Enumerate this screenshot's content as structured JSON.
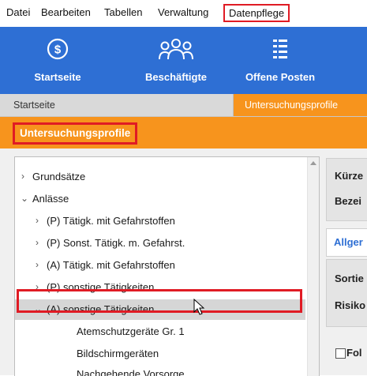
{
  "menubar": {
    "items": [
      "Datei",
      "Bearbeiten",
      "Tabellen",
      "Verwaltung",
      "Datenpflege"
    ]
  },
  "toolbar": {
    "buttons": [
      {
        "label": "Startseite",
        "icon": "home-dollar-icon"
      },
      {
        "label": "Beschäftigte",
        "icon": "people-group-icon"
      },
      {
        "label": "Offene Posten",
        "icon": "list-icon"
      }
    ]
  },
  "tabs": {
    "start": "Startseite",
    "active": "Untersuchungsprofile"
  },
  "title": "Untersuchungsprofile",
  "tree": {
    "items": [
      {
        "label": "Grundsätze",
        "state": "collapsed"
      },
      {
        "label": "Anlässe",
        "state": "expanded"
      },
      {
        "label": "(P) Tätigk. mit Gefahrstoffen",
        "state": "collapsed"
      },
      {
        "label": "(P) Sonst. Tätigk. m. Gefahrst.",
        "state": "collapsed"
      },
      {
        "label": "(A) Tätigk. mit Gefahrstoffen",
        "state": "collapsed"
      },
      {
        "label": "(P) sonstige Tätigkeiten",
        "state": "collapsed"
      },
      {
        "label": "(A) sonstige Tätigkeiten",
        "state": "expanded",
        "selected": true
      },
      {
        "label": "Atemschutzgeräte Gr. 1",
        "state": "leaf"
      },
      {
        "label": "Bildschirmgeräten",
        "state": "leaf"
      },
      {
        "label": "Nachgehende Vorsorge",
        "state": "leaf"
      }
    ]
  },
  "right_panel": {
    "field1": "Kürze",
    "field2": "Bezei",
    "tab": "Allger",
    "field3": "Sortie",
    "field4": "Risiko",
    "checkbox_label": "Fol"
  },
  "colors": {
    "toolbar": "#2e6fd4",
    "accent_orange": "#f7941d",
    "highlight_red": "#e01b24"
  }
}
